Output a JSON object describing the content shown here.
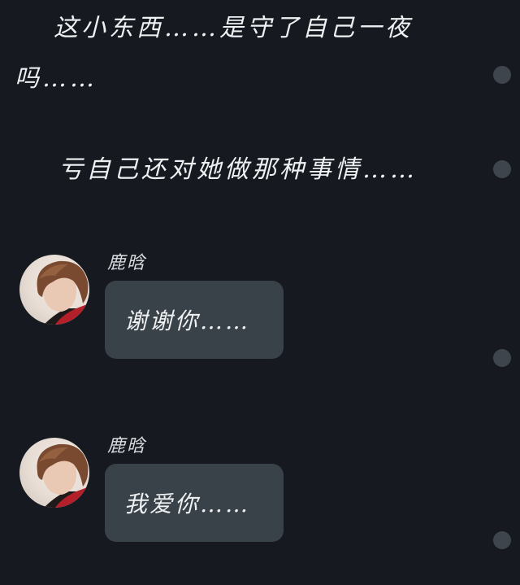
{
  "narration": [
    "这小东西……是守了自己一夜吗……",
    "亏自己还对她做那种事情……"
  ],
  "messages": [
    {
      "sender": "鹿晗",
      "text": "谢谢你……"
    },
    {
      "sender": "鹿晗",
      "text": "我爱你……"
    }
  ]
}
